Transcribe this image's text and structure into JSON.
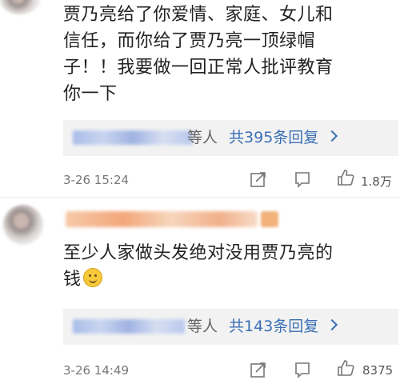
{
  "comments": [
    {
      "text_lines": [
        "贾乃亮给了你爱情、家庭、女儿和",
        "信任，而你给了贾乃亮一顶绿帽",
        "子！！我要做一回正常人批评教育",
        "你一下"
      ],
      "reply_who": "等人",
      "reply_count": "共395条回复",
      "timestamp": "3-26 15:24",
      "likes": "1.8万"
    },
    {
      "text_lines": [
        "至少人家做头发绝对没用贾乃亮的",
        "钱"
      ],
      "emoji_icon": "smile-emoji-icon",
      "reply_who": "等人",
      "reply_count": "共143条回复",
      "timestamp": "3-26 14:49",
      "likes": "8375"
    }
  ],
  "colors": {
    "link_blue": "#3a6fb5",
    "reply_bg": "#f2f2f2",
    "meta_gray": "#777777"
  },
  "icons": [
    "share-icon",
    "comment-icon",
    "like-thumb-icon",
    "chevron-right-icon"
  ]
}
